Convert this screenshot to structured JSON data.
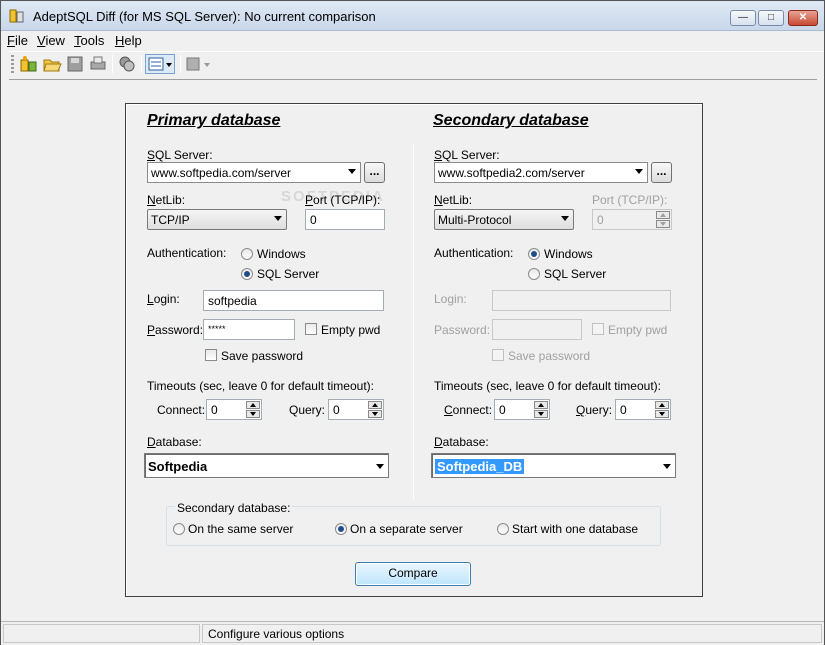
{
  "window": {
    "title": "AdeptSQL Diff (for MS SQL Server): No current comparison"
  },
  "menu": [
    "File",
    "View",
    "Tools",
    "Help"
  ],
  "toolbar": {
    "icons": [
      "new-comparison-icon",
      "open-folder-icon",
      "save-icon",
      "print-icon",
      "compare-db-icon",
      "options-dropdown-icon",
      "script-icon"
    ]
  },
  "primary": {
    "heading": "Primary database",
    "sql_server_label": "SQL Server:",
    "sql_server_value": "www.softpedia.com/server",
    "browse_label": "...",
    "netlib_label": "NetLib:",
    "netlib_value": "TCP/IP",
    "port_label": "Port (TCP/IP):",
    "port_value": "0",
    "auth_label": "Authentication:",
    "auth_windows": "Windows",
    "auth_sql": "SQL Server",
    "auth_selected": "SQL Server",
    "login_label": "Login:",
    "login_value": "softpedia",
    "password_label": "Password:",
    "password_value": "*****",
    "empty_pwd_label": "Empty pwd",
    "save_password_label": "Save password",
    "timeouts_label": "Timeouts (sec, leave 0 for default timeout):",
    "connect_label": "Connect:",
    "connect_value": "0",
    "query_label": "Query:",
    "query_value": "0",
    "database_label": "Database:",
    "database_value": "Softpedia"
  },
  "secondary": {
    "heading": "Secondary database",
    "sql_server_label": "SQL Server:",
    "sql_server_value": "www.softpedia2.com/server",
    "browse_label": "...",
    "netlib_label": "NetLib:",
    "netlib_value": "Multi-Protocol",
    "port_label": "Port (TCP/IP):",
    "port_value": "0",
    "auth_label": "Authentication:",
    "auth_windows": "Windows",
    "auth_sql": "SQL Server",
    "auth_selected": "Windows",
    "login_label": "Login:",
    "login_value": "",
    "password_label": "Password:",
    "password_value": "",
    "empty_pwd_label": "Empty pwd",
    "save_password_label": "Save password",
    "timeouts_label": "Timeouts (sec, leave 0 for default timeout):",
    "connect_label": "Connect:",
    "connect_value": "0",
    "query_label": "Query:",
    "query_value": "0",
    "database_label": "Database:",
    "database_value": "Softpedia_DB"
  },
  "secondary_mode": {
    "group_label": "Secondary database:",
    "options": [
      "On the same server",
      "On a separate server",
      "Start with one database"
    ],
    "selected": "On a separate server"
  },
  "compare_button": "Compare",
  "status": {
    "text": "Configure various options"
  },
  "watermark": "SOFTPEDIA"
}
